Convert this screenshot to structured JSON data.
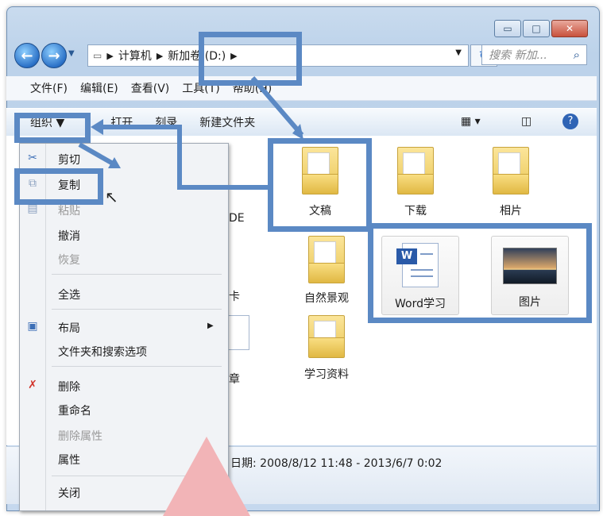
{
  "address": {
    "segments": [
      "计算机",
      "新加卷 (D:)"
    ],
    "search_placeholder": "搜索 新加..."
  },
  "menubar": [
    "文件(F)",
    "编辑(E)",
    "查看(V)",
    "工具(T)",
    "帮助(H)"
  ],
  "toolbar": {
    "organize": "组织 ▼",
    "open": "打开",
    "burn": "刻录",
    "new_folder": "新建文件夹"
  },
  "context_menu": {
    "cut": "剪切",
    "copy": "复制",
    "paste": "粘贴",
    "undo": "撤消",
    "redo": "恢复",
    "select_all": "全选",
    "layout": "布局",
    "folder_options": "文件夹和搜索选项",
    "delete": "删除",
    "rename": "重命名",
    "remove_props": "删除属性",
    "properties": "属性",
    "close": "关闭"
  },
  "items": {
    "wengao": "文稿",
    "xiazai": "下载",
    "xiangpian": "相片",
    "ziran": "自然景观",
    "xuexi": "学习资料",
    "word": "Word学习",
    "tupian": "图片",
    "partial_de": "DE",
    "partial_ka": "卡",
    "partial_zhang": "章"
  },
  "details": {
    "date_text": "日期: 2008/8/12 11:48 - 2013/6/7 0:02"
  },
  "colors": {
    "highlight": "#5b89c4",
    "pink_arrow": "#f2b4b7"
  }
}
